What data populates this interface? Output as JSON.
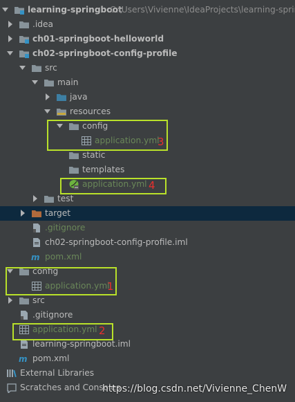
{
  "tree": {
    "items": [
      {
        "name": "learning-springboot",
        "path": "C:\\Users\\Vivienne\\IdeaProjects\\learning-sprin",
        "icon": "module-folder-icon"
      },
      {
        "name": ".idea",
        "icon": "folder-icon"
      },
      {
        "name": "ch01-springboot-helloworld",
        "icon": "module-folder-icon"
      },
      {
        "name": "ch02-springboot-config-profile",
        "icon": "module-folder-icon"
      },
      {
        "name": "src",
        "icon": "folder-icon"
      },
      {
        "name": "main",
        "icon": "folder-icon"
      },
      {
        "name": "java",
        "icon": "source-folder-icon"
      },
      {
        "name": "resources",
        "icon": "resources-folder-icon"
      },
      {
        "name": "config",
        "icon": "folder-icon"
      },
      {
        "name": "application.yml",
        "icon": "yml-file-icon"
      },
      {
        "name": "static",
        "icon": "folder-icon"
      },
      {
        "name": "templates",
        "icon": "folder-icon"
      },
      {
        "name": "application.yml",
        "icon": "spring-yml-icon"
      },
      {
        "name": "test",
        "icon": "folder-icon"
      },
      {
        "name": "target",
        "icon": "excluded-folder-icon"
      },
      {
        "name": ".gitignore",
        "icon": "gitignore-file-icon"
      },
      {
        "name": "ch02-springboot-config-profile.iml",
        "icon": "iml-file-icon"
      },
      {
        "name": "pom.xml",
        "icon": "maven-file-icon"
      },
      {
        "name": "config",
        "icon": "folder-icon"
      },
      {
        "name": "application.yml",
        "icon": "yml-file-icon"
      },
      {
        "name": "src",
        "icon": "folder-icon"
      },
      {
        "name": ".gitignore",
        "icon": "gitignore-file-icon"
      },
      {
        "name": "application.yml",
        "icon": "yml-file-icon"
      },
      {
        "name": "learning-springboot.iml",
        "icon": "iml-file-icon"
      },
      {
        "name": "pom.xml",
        "icon": "maven-file-icon"
      },
      {
        "name": "External Libraries",
        "icon": "libraries-icon"
      },
      {
        "name": "Scratches and Consoles",
        "icon": "scratches-icon"
      }
    ]
  },
  "annotations": {
    "n1": "1",
    "n2": "2",
    "n3": "3",
    "n4": "4"
  },
  "watermark": "https://blog.csdn.net/Vivienne_ChenW",
  "colors": {
    "background": "#3c3f41",
    "text": "#bbbbbb",
    "modified_green": "#6a8759",
    "selection": "#0d293e",
    "highlight_box": "#b9e12a",
    "annotation_red": "#e8302e"
  }
}
